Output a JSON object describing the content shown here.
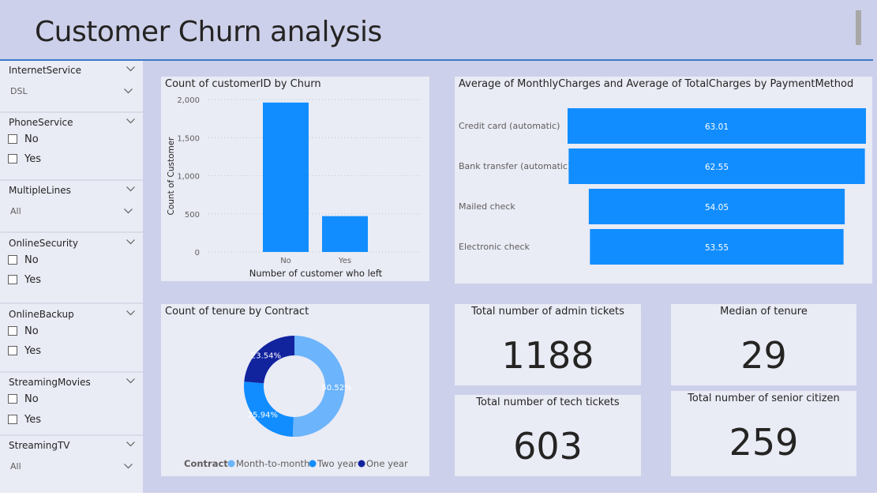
{
  "header": {
    "title": "Customer Churn analysis"
  },
  "slicers": {
    "internet_service": {
      "title": "InternetService",
      "value": "DSL"
    },
    "phone_service": {
      "title": "PhoneService",
      "options": [
        "No",
        "Yes"
      ]
    },
    "multiple_lines": {
      "title": "MultipleLines",
      "value": "All"
    },
    "online_security": {
      "title": "OnlineSecurity",
      "options": [
        "No",
        "Yes"
      ]
    },
    "online_backup": {
      "title": "OnlineBackup",
      "options": [
        "No",
        "Yes"
      ]
    },
    "streaming_movies": {
      "title": "StreamingMovies",
      "options": [
        "No",
        "Yes"
      ]
    },
    "streaming_tv": {
      "title": "StreamingTV",
      "value": "All"
    }
  },
  "colors": {
    "bar": "#118dff",
    "month_to_month": "#6cb4fb",
    "two_year": "#118dff",
    "one_year": "#12239e"
  },
  "kpis": {
    "admin_tickets": {
      "title": "Total number of admin tickets",
      "value": "1188"
    },
    "median_tenure": {
      "title": "Median of tenure",
      "value": "29"
    },
    "tech_tickets": {
      "title": "Total number of tech tickets",
      "value": "603"
    },
    "senior_citizen": {
      "title": "Total number of senior citizen",
      "value": "259"
    }
  },
  "chart_data": [
    {
      "type": "bar",
      "title": "Count of customerID by Churn",
      "categories": [
        "No",
        "Yes"
      ],
      "values": [
        1960,
        470
      ],
      "xlabel": "Number of customer who left",
      "ylabel": "Count of Customer",
      "yticks": [
        "0",
        "500",
        "1,000",
        "1,500",
        "2,000"
      ],
      "ylim": [
        0,
        2000
      ]
    },
    {
      "type": "bar",
      "orientation": "horizontal",
      "title": "Average of MonthlyCharges and Average of TotalCharges by PaymentMethod",
      "categories": [
        "Credit card (automatic)",
        "Bank transfer (automatic)",
        "Mailed check",
        "Electronic check"
      ],
      "values": [
        63.01,
        62.55,
        54.05,
        53.55
      ],
      "labels": [
        "63.01",
        "62.55",
        "54.05",
        "53.55"
      ]
    },
    {
      "type": "pie",
      "title": "Count of tenure by Contract",
      "legend_title": "Contract",
      "categories": [
        "Month-to-month",
        "Two year",
        "One year"
      ],
      "values": [
        50.52,
        25.94,
        23.54
      ],
      "labels": [
        "50.52%",
        "25.94%",
        "23.54%"
      ]
    }
  ]
}
